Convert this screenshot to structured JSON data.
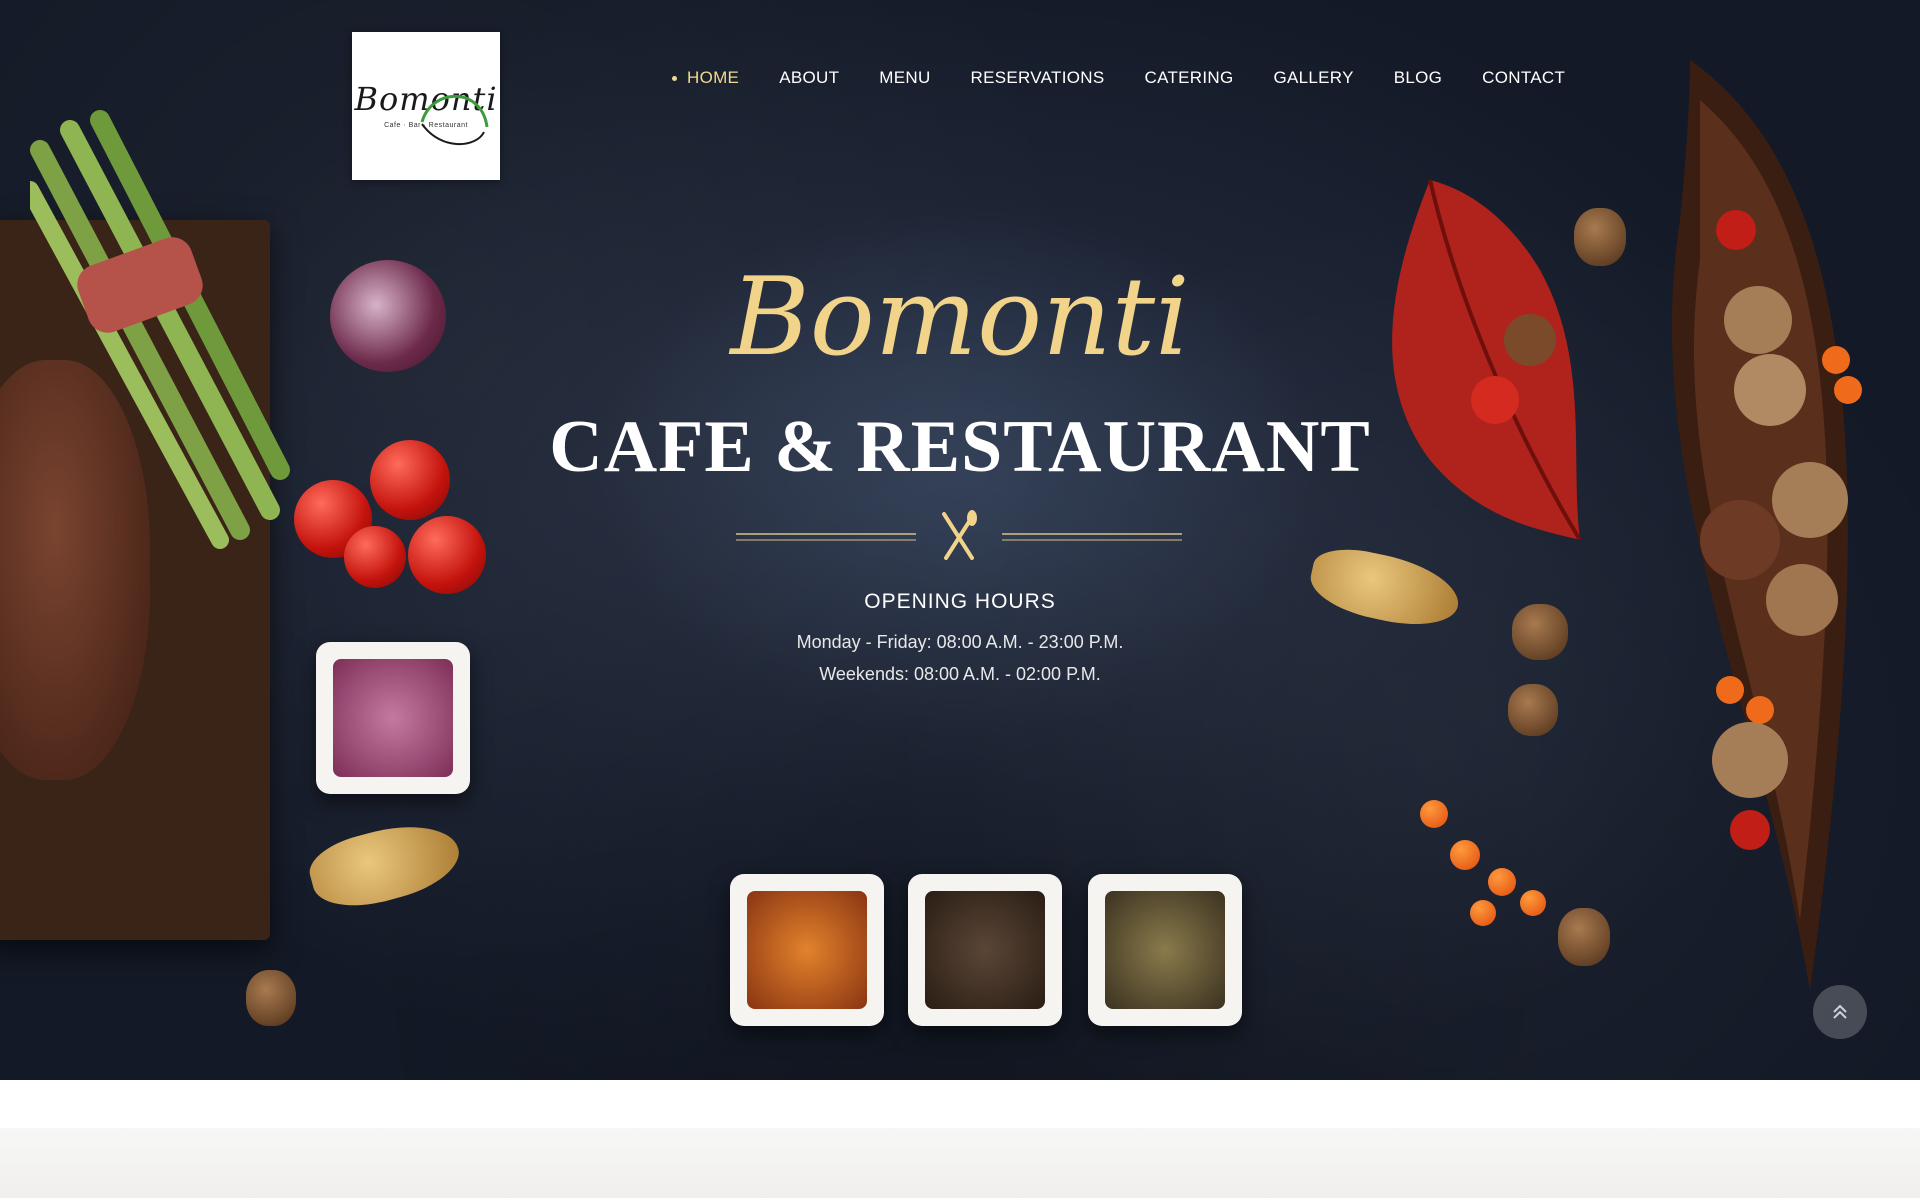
{
  "logo": {
    "word": "Bomonti",
    "tagline": "Cafe · Bar · Restaurant"
  },
  "nav": {
    "items": [
      {
        "label": "HOME",
        "active": true
      },
      {
        "label": "ABOUT"
      },
      {
        "label": "MENU"
      },
      {
        "label": "RESERVATIONS"
      },
      {
        "label": "CATERING"
      },
      {
        "label": "GALLERY"
      },
      {
        "label": "BLOG"
      },
      {
        "label": "CONTACT"
      }
    ]
  },
  "hero": {
    "brand": "Bomonti",
    "headline": "CAFE & RESTAURANT",
    "divider_icon": "fork-knife-icon",
    "hours_title": "OPENING HOURS",
    "hours_weekday": "Monday - Friday: 08:00 A.M. - 23:00 P.M.",
    "hours_weekend": "Weekends: 08:00 A.M. - 02:00 P.M."
  },
  "scroll_top_icon": "double-chevron-up-icon",
  "colors": {
    "accent": "#f1d38a",
    "background": "#1c2333",
    "nav_active": "#f3d98e"
  }
}
